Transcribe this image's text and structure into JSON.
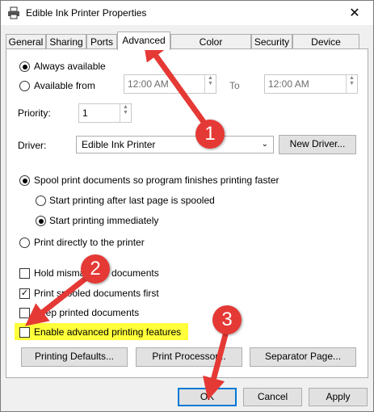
{
  "window": {
    "title": "Edible Ink Printer Properties",
    "close_glyph": "✕"
  },
  "tabs": [
    "General",
    "Sharing",
    "Ports",
    "Advanced",
    "Color Management",
    "Security",
    "Device Settings"
  ],
  "active_tab": "Advanced",
  "availability": {
    "always_label": "Always available",
    "from_label": "Available from",
    "from_time": "12:00 AM",
    "to_label": "To",
    "to_time": "12:00 AM",
    "selected": "always"
  },
  "priority": {
    "label": "Priority:",
    "value": "1"
  },
  "driver": {
    "label": "Driver:",
    "value": "Edible Ink Printer",
    "new_driver_label": "New Driver..."
  },
  "spool": {
    "spool_label": "Spool print documents so program finishes printing faster",
    "start_after_label": "Start printing after last page is spooled",
    "start_immediately_label": "Start printing immediately",
    "direct_label": "Print directly to the printer"
  },
  "options": {
    "hold_label": "Hold mismatched documents",
    "spooled_first_label": "Print spooled documents first",
    "keep_label": "Keep printed documents",
    "enable_advanced_label": "Enable advanced printing features",
    "hold_checked": false,
    "spooled_first_checked": true,
    "keep_checked": false,
    "enable_advanced_checked": false
  },
  "panel_buttons": {
    "defaults": "Printing Defaults...",
    "processor": "Print Processor...",
    "separator": "Separator Page..."
  },
  "footer": {
    "ok": "OK",
    "cancel": "Cancel",
    "apply": "Apply"
  },
  "annotations": [
    "1",
    "2",
    "3"
  ],
  "colors": {
    "highlight": "#ffff3a",
    "annotation_red": "#e53935",
    "focus_blue": "#0078d7"
  }
}
